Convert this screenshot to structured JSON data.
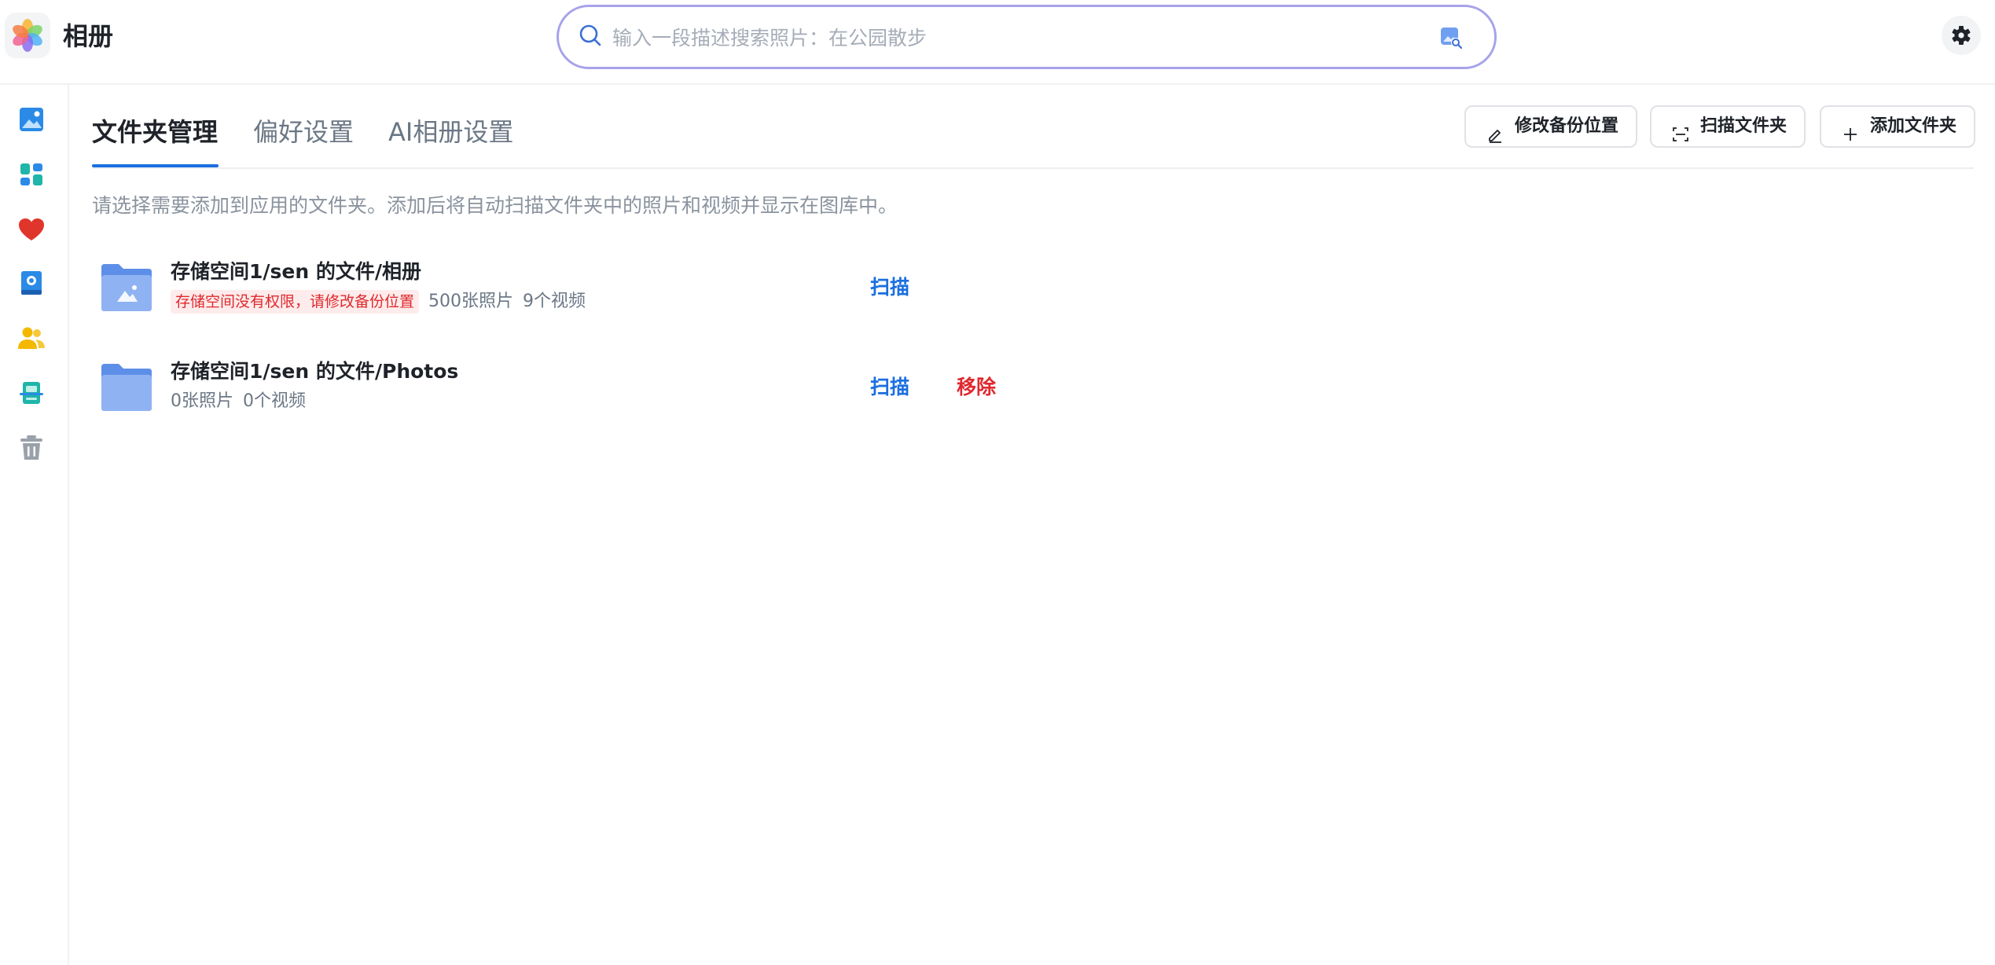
{
  "app": {
    "title": "相册"
  },
  "search": {
    "placeholder": "输入一段描述搜索照片：在公园散步"
  },
  "sidebar": {
    "items": [
      {
        "name": "photos",
        "icon": "image-icon",
        "color": "#2a8ae6"
      },
      {
        "name": "albums",
        "icon": "albums-grid-icon",
        "color": "#1fb5a8"
      },
      {
        "name": "favorites",
        "icon": "heart-icon",
        "color": "#e0352b"
      },
      {
        "name": "memories",
        "icon": "photo-book-icon",
        "color": "#2a8ae6"
      },
      {
        "name": "people",
        "icon": "people-icon",
        "color": "#f5b800"
      },
      {
        "name": "scan",
        "icon": "document-scan-icon",
        "color": "#1fb5a8"
      },
      {
        "name": "trash",
        "icon": "trash-icon",
        "color": "#9aa1ab"
      }
    ]
  },
  "tabs": [
    {
      "label": "文件夹管理",
      "active": true
    },
    {
      "label": "偏好设置",
      "active": false
    },
    {
      "label": "AI相册设置",
      "active": false
    }
  ],
  "toolbar": {
    "edit_backup_label": "修改备份位置",
    "scan_folder_label": "扫描文件夹",
    "add_folder_label": "添加文件夹"
  },
  "hint": "请选择需要添加到应用的文件夹。添加后将自动扫描文件夹中的照片和视频并显示在图库中。",
  "folders": [
    {
      "name": "存储空间1/sen 的文件/相册",
      "warning": "存储空间没有权限，请修改备份位置",
      "photos": "500张照片",
      "videos": "9个视频",
      "scan_label": "扫描"
    },
    {
      "name": "存储空间1/sen 的文件/Photos",
      "photos": "0张照片",
      "videos": "0个视频",
      "scan_label": "扫描",
      "remove_label": "移除"
    }
  ],
  "colors": {
    "accent": "#1a6fe0",
    "danger": "#e0282e",
    "search_border": "#a7a3ea"
  }
}
